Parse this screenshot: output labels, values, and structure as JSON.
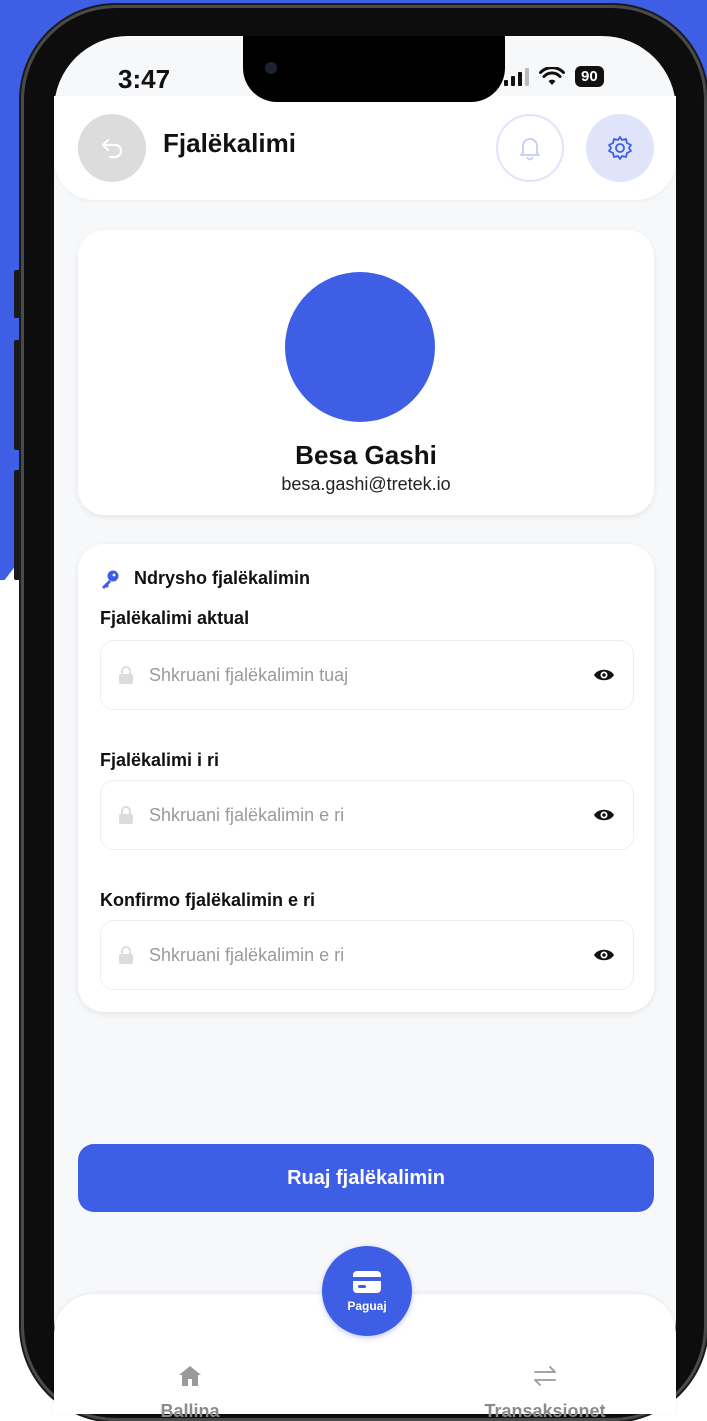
{
  "status_bar": {
    "time": "3:47",
    "battery": "90"
  },
  "header": {
    "title": "Fjalëkalimi"
  },
  "profile": {
    "name": "Besa Gashi",
    "email": "besa.gashi@tretek.io"
  },
  "password_section": {
    "heading": "Ndrysho fjalëkalimin",
    "fields": [
      {
        "label": "Fjalëkalimi aktual",
        "placeholder": "Shkruani fjalëkalimin tuaj",
        "value": ""
      },
      {
        "label": "Fjalëkalimi i ri",
        "placeholder": "Shkruani fjalëkalimin e ri",
        "value": ""
      },
      {
        "label": "Konfirmo fjalëkalimin e ri",
        "placeholder": "Shkruani fjalëkalimin e ri",
        "value": ""
      }
    ]
  },
  "save_button": {
    "label": "Ruaj fjalëkalimin"
  },
  "bottom_nav": {
    "home_label": "Ballina",
    "pay_label": "Paguaj",
    "transactions_label": "Transaksionet"
  },
  "colors": {
    "accent": "#3f5ee6",
    "accent_light": "#dfe4fb",
    "background": "#f7f8fa"
  },
  "icons": [
    "back-icon",
    "bell-icon",
    "gear-icon",
    "key-icon",
    "lock-icon",
    "eye-icon",
    "home-icon",
    "card-icon",
    "transfer-icon"
  ]
}
